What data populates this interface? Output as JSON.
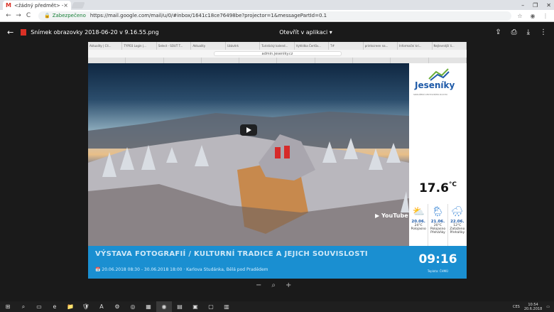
{
  "browser": {
    "tab_title": "<žádný předmět> - bez",
    "tab_close": "×",
    "nav_back": "←",
    "nav_forward": "→",
    "nav_reload": "C",
    "secure_label": "Zabezpečeno",
    "url": "https://mail.google.com/mail/u/0/#inbox/1641c18ce76498be?projector=1&messagePartId=0.1",
    "win_min": "–",
    "win_max": "❐",
    "win_close": "✕"
  },
  "viewer": {
    "back": "←",
    "file_name": "Snímek obrazovky 2018-06-20 v 9.16.55.png",
    "open_with": "Otevřít v aplikaci ▾",
    "actions": [
      "⇪",
      "⎙",
      "⤓",
      "⋮"
    ],
    "zoom_out": "−",
    "zoom_icon": "⌕",
    "zoom_in": "+"
  },
  "screenshot": {
    "tabs": [
      "Aktuality | Cll...",
      "TYPO3 Login |...",
      "Select - SOUT T...",
      "Aktuality",
      "Uzávěrk",
      "Turistický kalend...",
      "Vyhlídka Čertův...",
      "T#",
      "printscreen na...",
      "Informační kri...",
      "Nejlevnější li..."
    ],
    "address": "admin.jeseniky.cz",
    "brand": {
      "name": "Jeseníky",
      "tagline": "SDRUŽENÍ CESTOVNÍHO RUCHU"
    },
    "temperature": "17.6",
    "temp_unit": "°C",
    "forecast": [
      {
        "icon": "⛅",
        "date": "20.06.",
        "temp": "24°C",
        "desc": "Polojasno"
      },
      {
        "icon": "🌦",
        "date": "21.06.",
        "temp": "20°C",
        "desc": "Polojasno Přeháňky"
      },
      {
        "icon": "🌧",
        "date": "22.06.",
        "temp": "12°C",
        "desc": "Zataženo Přeháňky"
      }
    ],
    "banner_title": "VÝSTAVA FOTOGRAFIÍ / KULTURNÍ TRADICE A JEJICH SOUVISLOSTI",
    "banner_sub": "📅 20.06.2018 08:30 - 30.06.2018 18:00 · Karlova Studánka, Bělá pod Pradědem",
    "youtube": "▶ YouTube",
    "clock": "09:16",
    "clock_src": "Teplota: ČHMÚ"
  },
  "taskbar": {
    "icons": [
      "⊞",
      "⌕",
      "▭",
      "e",
      "📁",
      "🛡",
      "A",
      "⚙",
      "◎",
      "▦",
      "◉",
      "▤",
      "▣",
      "▢",
      "▥"
    ],
    "tray_lang": "CES",
    "time": "10:54",
    "date": "20.6.2018"
  }
}
